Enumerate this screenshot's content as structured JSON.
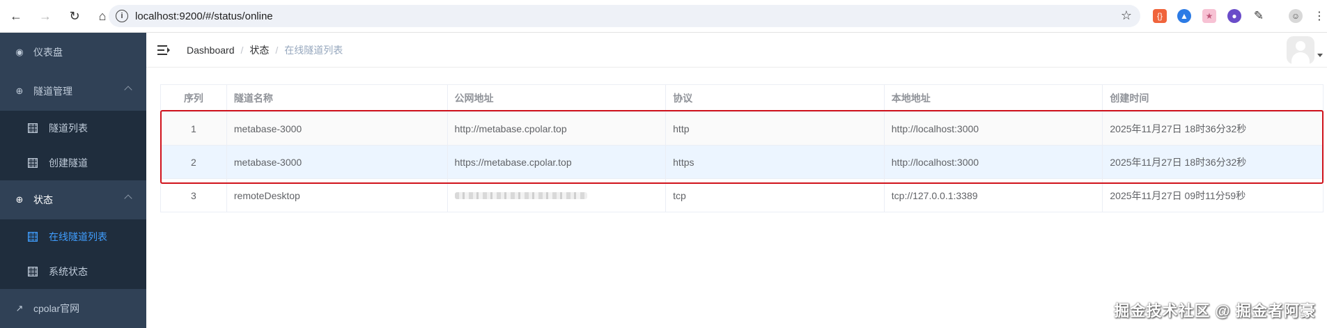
{
  "browser": {
    "url": "localhost:9200/#/status/online",
    "extensions": [
      "ext-orange-icon",
      "ext-blue-icon",
      "ext-pink-icon",
      "ext-purple-icon",
      "puzzle-icon",
      "profile-icon",
      "menu-icon"
    ]
  },
  "sidebar": {
    "items": [
      {
        "label": "仪表盘"
      },
      {
        "label": "隧道管理"
      },
      {
        "label": "隧道列表"
      },
      {
        "label": "创建隧道"
      },
      {
        "label": "状态"
      },
      {
        "label": "在线隧道列表"
      },
      {
        "label": "系统状态"
      },
      {
        "label": "cpolar官网"
      }
    ],
    "active_color": "#409eff",
    "bg_color": "#304156"
  },
  "breadcrumb": {
    "items": [
      "Dashboard",
      "状态",
      "在线隧道列表"
    ],
    "separator": "/"
  },
  "table": {
    "headers": [
      "序列",
      "隧道名称",
      "公网地址",
      "协议",
      "本地地址",
      "创建时间"
    ],
    "rows": [
      [
        "1",
        "metabase-3000",
        "http://metabase.cpolar.top",
        "http",
        "http://localhost:3000",
        "2025年11月27日 18时36分32秒"
      ],
      [
        "2",
        "metabase-3000",
        "https://metabase.cpolar.top",
        "https",
        "http://localhost:3000",
        "2025年11月27日 18时36分32秒"
      ],
      [
        "3",
        "remoteDesktop",
        "",
        "tcp",
        "tcp://127.0.0.1:3389",
        "2025年11月27日 09时11分59秒"
      ]
    ]
  },
  "watermark": "掘金技术社区 @ 掘金者阿豪",
  "highlight_color": "#d0121b"
}
